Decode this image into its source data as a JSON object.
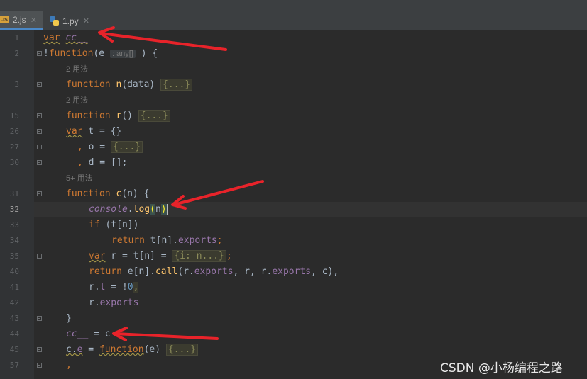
{
  "tabs": [
    {
      "label": "2.js",
      "active": true,
      "icon": "js-file-icon"
    },
    {
      "label": "1.py",
      "active": false,
      "icon": "python-file-icon"
    }
  ],
  "gutter": [
    "1",
    "2",
    "3",
    "15",
    "26",
    "27",
    "30",
    "31",
    "32",
    "33",
    "34",
    "35",
    "40",
    "41",
    "42",
    "43",
    "44",
    "45",
    "57"
  ],
  "usages": {
    "n": "2 用法",
    "r": "2 用法",
    "c": "5+ 用法"
  },
  "code": {
    "l1_kw": "var",
    "l1_var": "cc__",
    "l2_a": "!",
    "l2_kw": "function",
    "l2_b": "(e",
    "l2_hint": ": any[]",
    "l2_c": " ) {",
    "l3_kw": "function",
    "l3_fn": "n",
    "l3_a": "(data) ",
    "l3_fold": "{...}",
    "l15_kw": "function",
    "l15_fn": "r",
    "l15_a": "() ",
    "l15_fold": "{...}",
    "l26_kw": "var",
    "l26_a": " t = {}",
    "l27_a": ", ",
    "l27_b": "o = ",
    "l27_fold": "{...}",
    "l30_a": ", ",
    "l30_b": "d = [];",
    "l31_kw": "function",
    "l31_fn": "c",
    "l31_a": "(n) {",
    "l32_obj": "console",
    "l32_a": ".",
    "l32_fn": "log",
    "l32_p1": "(",
    "l32_arg": "n",
    "l32_p2": ")",
    "l33_kw": "if",
    "l33_a": " (t[n])",
    "l34_kw": "return",
    "l34_a": " t[n].",
    "l34_prop": "exports",
    "l34_b": ";",
    "l35_kw": "var",
    "l35_a": " r = t[n] = ",
    "l35_fold": "{i: n...}",
    "l35_b": ";",
    "l40_kw": "return",
    "l40_a": " e[n].",
    "l40_fn": "call",
    "l40_b": "(r.",
    "l40_prop1": "exports",
    "l40_c": ", r, r.",
    "l40_prop2": "exports",
    "l40_d": ", c),",
    "l41_a": "r.",
    "l41_prop": "l",
    "l41_b": " = !",
    "l41_num": "0",
    "l41_c": ",",
    "l42_a": "r.",
    "l42_prop": "exports",
    "l43_a": "}",
    "l44_var": "cc__",
    "l44_a": " = c",
    "l45_a": "c.",
    "l45_prop": "e",
    "l45_b": " = ",
    "l45_kw": "function",
    "l45_c": "(e) ",
    "l45_fold": "{...}",
    "l57_a": ","
  },
  "watermark": "CSDN @小杨编程之路",
  "annotation_color": "#e8232a"
}
